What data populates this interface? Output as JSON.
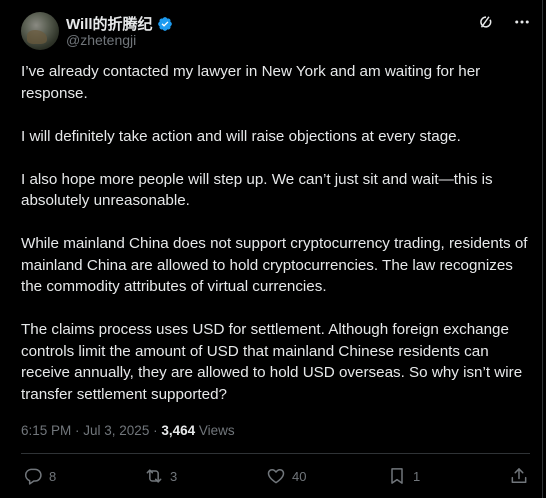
{
  "author": {
    "display_name": "Will的折腾纪",
    "handle": "@zhetengji",
    "verified": true
  },
  "paragraphs": [
    "I’ve already contacted my lawyer in New York and am waiting for her response.",
    "I will definitely take action and will raise objections at every stage.",
    "I also hope more people will step up. We can’t just sit and wait—this is absolutely unreasonable.",
    "While mainland China does not support cryptocurrency trading, residents of mainland China are allowed to hold cryptocurrencies. The law recognizes the commodity attributes of virtual currencies.",
    "The claims process uses USD for settlement. Although foreign exchange controls limit the amount of USD that mainland Chinese residents can receive annually, they are allowed to hold USD overseas. So why isn’t wire transfer settlement supported?"
  ],
  "meta": {
    "timestamp": "6:15 PM · Jul 3, 2025 · ",
    "views_count": "3,464",
    "views_label": " Views"
  },
  "actions": {
    "replies": "8",
    "reposts": "3",
    "likes": "40",
    "bookmarks": "1"
  },
  "colors": {
    "background": "#000000",
    "text": "#e7e9ea",
    "secondary": "#71767b",
    "verified": "#1d9bf0",
    "divider": "#2f3336"
  },
  "icons": [
    "verified-badge-icon",
    "grok-icon",
    "more-icon",
    "reply-icon",
    "repost-icon",
    "like-icon",
    "bookmark-icon",
    "share-icon"
  ]
}
